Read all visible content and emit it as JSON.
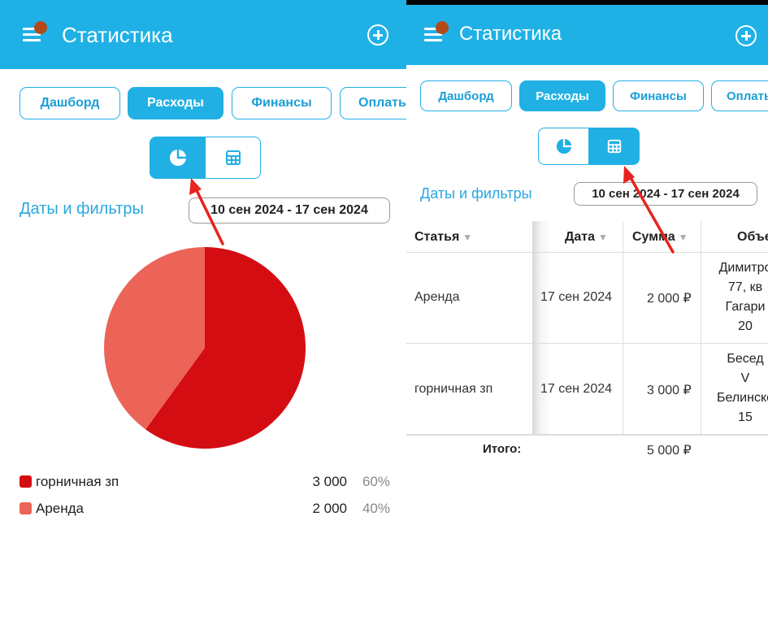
{
  "app": {
    "title": "Статистика"
  },
  "tabs": [
    "Дашборд",
    "Расходы",
    "Финансы",
    "Оплаты"
  ],
  "filters": {
    "label": "Даты и фильтры",
    "date_range": "10 сен 2024 - 17 сен 2024"
  },
  "icons": {
    "menu": "hamburger-menu-icon",
    "add": "plus-circle-icon",
    "chart": "pie-chart-icon",
    "table": "table-icon",
    "pointer": "red-arrow-annotation"
  },
  "colors": {
    "appbar": "#1fb1e6",
    "accent": "#21b0e4",
    "series_1": "#d40d12",
    "series_2": "#ec6358",
    "annotation": "#e8231f"
  },
  "chart_data": {
    "type": "pie",
    "slices": [
      {
        "label": "горничная зп",
        "value": 3000,
        "value_text": "3 000",
        "percent": "60%",
        "color": "#d40d12"
      },
      {
        "label": "Аренда",
        "value": 2000,
        "value_text": "2 000",
        "percent": "40%",
        "color": "#ec6358"
      }
    ]
  },
  "table": {
    "headers": [
      "Статья",
      "Дата",
      "Сумма",
      "Объе"
    ],
    "rows": [
      {
        "article": "Аренда",
        "date": "17 сен 2024",
        "amount": "2 000 ₽",
        "object_lines": [
          "Димитро",
          "77, кв",
          "Гагари",
          "20"
        ]
      },
      {
        "article": "горничная зп",
        "date": "17 сен 2024",
        "amount": "3 000 ₽",
        "object_lines": [
          "Бесед",
          "V",
          "Белинско",
          "15"
        ]
      }
    ],
    "total_label": "Итого:",
    "total_value": "5 000 ₽"
  }
}
